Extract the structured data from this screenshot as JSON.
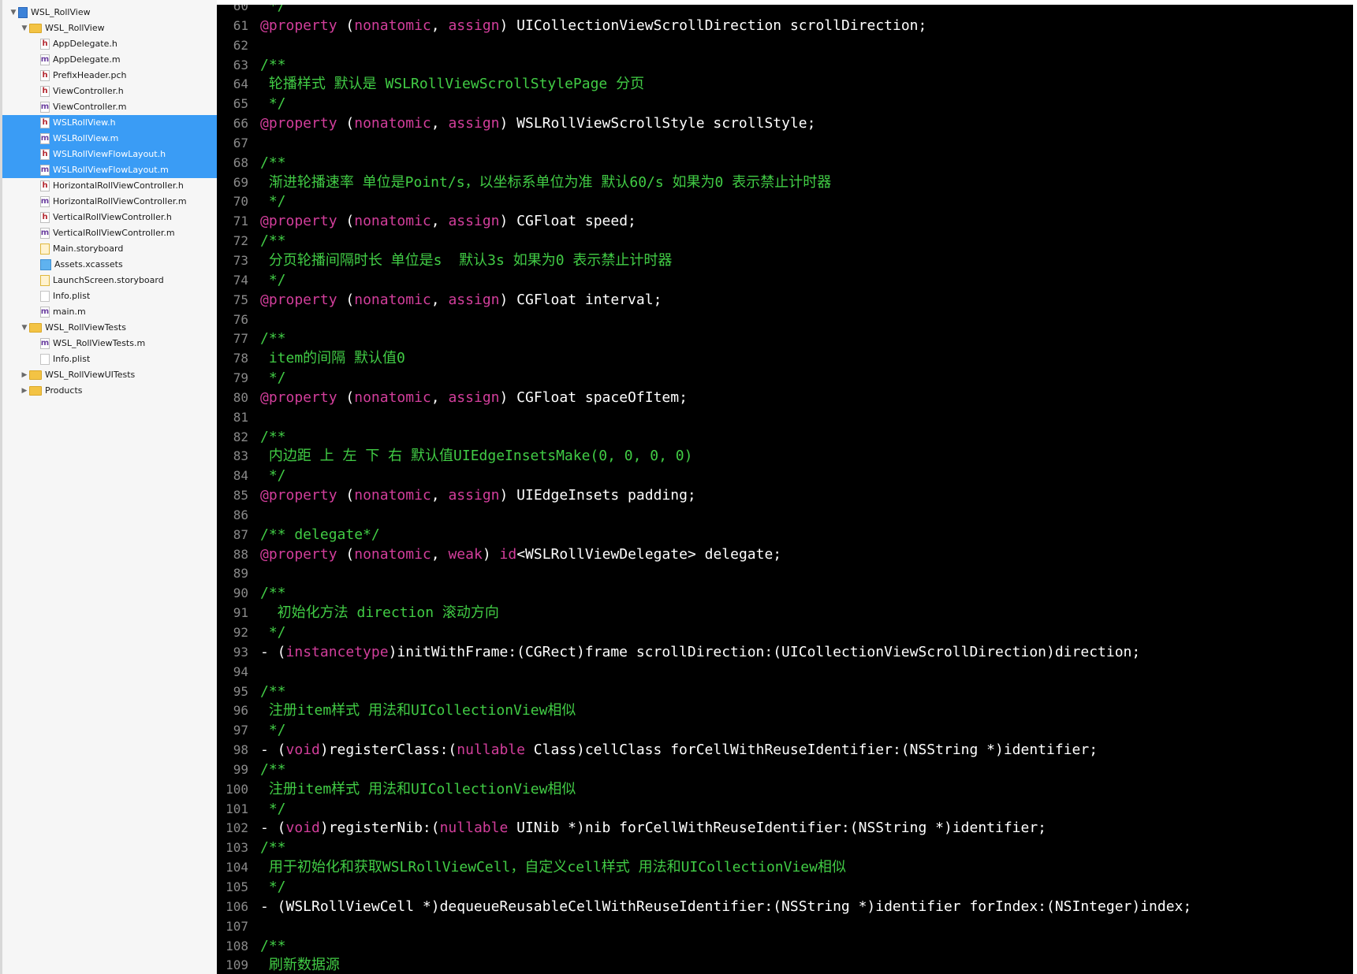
{
  "navigator": {
    "items": [
      {
        "label": "WSL_RollView",
        "kind": "project",
        "depth": 0,
        "disclosure": "open",
        "selected": false,
        "icon": "project-icon"
      },
      {
        "label": "WSL_RollView",
        "kind": "folder",
        "depth": 1,
        "disclosure": "open",
        "selected": false,
        "icon": "folder-icon"
      },
      {
        "label": "AppDelegate.h",
        "kind": "header-file",
        "depth": 2,
        "selected": false,
        "icon": "header-file-icon",
        "glyph": "h"
      },
      {
        "label": "AppDelegate.m",
        "kind": "impl-file",
        "depth": 2,
        "selected": false,
        "icon": "objc-file-icon",
        "glyph": "m"
      },
      {
        "label": "PrefixHeader.pch",
        "kind": "header-file",
        "depth": 2,
        "selected": false,
        "icon": "header-file-icon",
        "glyph": "h"
      },
      {
        "label": "ViewController.h",
        "kind": "header-file",
        "depth": 2,
        "selected": false,
        "icon": "header-file-icon",
        "glyph": "h"
      },
      {
        "label": "ViewController.m",
        "kind": "impl-file",
        "depth": 2,
        "selected": false,
        "icon": "objc-file-icon",
        "glyph": "m"
      },
      {
        "label": "WSLRollView.h",
        "kind": "header-file",
        "depth": 2,
        "selected": true,
        "icon": "header-file-icon",
        "glyph": "h"
      },
      {
        "label": "WSLRollView.m",
        "kind": "impl-file",
        "depth": 2,
        "selected": true,
        "icon": "objc-file-icon",
        "glyph": "m"
      },
      {
        "label": "WSLRollViewFlowLayout.h",
        "kind": "header-file",
        "depth": 2,
        "selected": true,
        "icon": "header-file-icon",
        "glyph": "h"
      },
      {
        "label": "WSLRollViewFlowLayout.m",
        "kind": "impl-file",
        "depth": 2,
        "selected": true,
        "icon": "objc-file-icon",
        "glyph": "m"
      },
      {
        "label": "HorizontalRollViewController.h",
        "kind": "header-file",
        "depth": 2,
        "selected": false,
        "icon": "header-file-icon",
        "glyph": "h"
      },
      {
        "label": "HorizontalRollViewController.m",
        "kind": "impl-file",
        "depth": 2,
        "selected": false,
        "icon": "objc-file-icon",
        "glyph": "m"
      },
      {
        "label": "VerticalRollViewController.h",
        "kind": "header-file",
        "depth": 2,
        "selected": false,
        "icon": "header-file-icon",
        "glyph": "h"
      },
      {
        "label": "VerticalRollViewController.m",
        "kind": "impl-file",
        "depth": 2,
        "selected": false,
        "icon": "objc-file-icon",
        "glyph": "m"
      },
      {
        "label": "Main.storyboard",
        "kind": "storyboard-file",
        "depth": 2,
        "selected": false,
        "icon": "storyboard-file-icon",
        "glyph": ""
      },
      {
        "label": "Assets.xcassets",
        "kind": "assets-file",
        "depth": 2,
        "selected": false,
        "icon": "asset-catalog-icon",
        "glyph": ""
      },
      {
        "label": "LaunchScreen.storyboard",
        "kind": "storyboard-file",
        "depth": 2,
        "selected": false,
        "icon": "storyboard-file-icon",
        "glyph": ""
      },
      {
        "label": "Info.plist",
        "kind": "plist-file",
        "depth": 2,
        "selected": false,
        "icon": "plist-file-icon",
        "glyph": ""
      },
      {
        "label": "main.m",
        "kind": "impl-file",
        "depth": 2,
        "selected": false,
        "icon": "objc-file-icon",
        "glyph": "m"
      },
      {
        "label": "WSL_RollViewTests",
        "kind": "folder",
        "depth": 1,
        "disclosure": "open",
        "selected": false,
        "icon": "folder-icon"
      },
      {
        "label": "WSL_RollViewTests.m",
        "kind": "impl-file",
        "depth": 2,
        "selected": false,
        "icon": "objc-file-icon",
        "glyph": "m"
      },
      {
        "label": "Info.plist",
        "kind": "plist-file",
        "depth": 2,
        "selected": false,
        "icon": "plist-file-icon",
        "glyph": ""
      },
      {
        "label": "WSL_RollViewUITests",
        "kind": "folder",
        "depth": 1,
        "disclosure": "closed",
        "selected": false,
        "icon": "folder-icon"
      },
      {
        "label": "Products",
        "kind": "folder",
        "depth": 1,
        "disclosure": "closed",
        "selected": false,
        "icon": "folder-icon"
      }
    ]
  },
  "editor": {
    "colors": {
      "background": "#000000",
      "comment": "#41cc45",
      "keyword": "#d23e9b",
      "plain": "#ffffff",
      "line_number": "#8a8a8a"
    },
    "lines": [
      {
        "n": "60",
        "tokens": [
          {
            "t": " */",
            "c": "com"
          }
        ]
      },
      {
        "n": "61",
        "tokens": [
          {
            "t": "@property",
            "c": "kw"
          },
          {
            "t": " (",
            "c": "plain"
          },
          {
            "t": "nonatomic",
            "c": "kw"
          },
          {
            "t": ", ",
            "c": "plain"
          },
          {
            "t": "assign",
            "c": "kw"
          },
          {
            "t": ") UICollectionViewScrollDirection scrollDirection;",
            "c": "plain"
          }
        ]
      },
      {
        "n": "62",
        "tokens": []
      },
      {
        "n": "63",
        "tokens": [
          {
            "t": "/**",
            "c": "com"
          }
        ]
      },
      {
        "n": "64",
        "tokens": [
          {
            "t": " 轮播样式 默认是 WSLRollViewScrollStylePage 分页",
            "c": "com"
          }
        ]
      },
      {
        "n": "65",
        "tokens": [
          {
            "t": " */",
            "c": "com"
          }
        ]
      },
      {
        "n": "66",
        "tokens": [
          {
            "t": "@property",
            "c": "kw"
          },
          {
            "t": " (",
            "c": "plain"
          },
          {
            "t": "nonatomic",
            "c": "kw"
          },
          {
            "t": ", ",
            "c": "plain"
          },
          {
            "t": "assign",
            "c": "kw"
          },
          {
            "t": ") WSLRollViewScrollStyle scrollStyle;",
            "c": "plain"
          }
        ]
      },
      {
        "n": "67",
        "tokens": []
      },
      {
        "n": "68",
        "tokens": [
          {
            "t": "/**",
            "c": "com"
          }
        ]
      },
      {
        "n": "69",
        "tokens": [
          {
            "t": " 渐进轮播速率 单位是Point/s，以坐标系单位为准 默认60/s 如果为0 表示禁止计时器",
            "c": "com"
          }
        ]
      },
      {
        "n": "70",
        "tokens": [
          {
            "t": " */",
            "c": "com"
          }
        ]
      },
      {
        "n": "71",
        "tokens": [
          {
            "t": "@property",
            "c": "kw"
          },
          {
            "t": " (",
            "c": "plain"
          },
          {
            "t": "nonatomic",
            "c": "kw"
          },
          {
            "t": ", ",
            "c": "plain"
          },
          {
            "t": "assign",
            "c": "kw"
          },
          {
            "t": ") CGFloat speed;",
            "c": "plain"
          }
        ]
      },
      {
        "n": "72",
        "tokens": [
          {
            "t": "/**",
            "c": "com"
          }
        ]
      },
      {
        "n": "73",
        "tokens": [
          {
            "t": " 分页轮播间隔时长 单位是s  默认3s 如果为0 表示禁止计时器",
            "c": "com"
          }
        ]
      },
      {
        "n": "74",
        "tokens": [
          {
            "t": " */",
            "c": "com"
          }
        ]
      },
      {
        "n": "75",
        "tokens": [
          {
            "t": "@property",
            "c": "kw"
          },
          {
            "t": " (",
            "c": "plain"
          },
          {
            "t": "nonatomic",
            "c": "kw"
          },
          {
            "t": ", ",
            "c": "plain"
          },
          {
            "t": "assign",
            "c": "kw"
          },
          {
            "t": ") CGFloat interval;",
            "c": "plain"
          }
        ]
      },
      {
        "n": "76",
        "tokens": []
      },
      {
        "n": "77",
        "tokens": [
          {
            "t": "/**",
            "c": "com"
          }
        ]
      },
      {
        "n": "78",
        "tokens": [
          {
            "t": " item的间隔 默认值0",
            "c": "com"
          }
        ]
      },
      {
        "n": "79",
        "tokens": [
          {
            "t": " */",
            "c": "com"
          }
        ]
      },
      {
        "n": "80",
        "tokens": [
          {
            "t": "@property",
            "c": "kw"
          },
          {
            "t": " (",
            "c": "plain"
          },
          {
            "t": "nonatomic",
            "c": "kw"
          },
          {
            "t": ", ",
            "c": "plain"
          },
          {
            "t": "assign",
            "c": "kw"
          },
          {
            "t": ") CGFloat spaceOfItem;",
            "c": "plain"
          }
        ]
      },
      {
        "n": "81",
        "tokens": []
      },
      {
        "n": "82",
        "tokens": [
          {
            "t": "/**",
            "c": "com"
          }
        ]
      },
      {
        "n": "83",
        "tokens": [
          {
            "t": " 内边距 上 左 下 右 默认值UIEdgeInsetsMake(0, 0, 0, 0)",
            "c": "com"
          }
        ]
      },
      {
        "n": "84",
        "tokens": [
          {
            "t": " */",
            "c": "com"
          }
        ]
      },
      {
        "n": "85",
        "tokens": [
          {
            "t": "@property",
            "c": "kw"
          },
          {
            "t": " (",
            "c": "plain"
          },
          {
            "t": "nonatomic",
            "c": "kw"
          },
          {
            "t": ", ",
            "c": "plain"
          },
          {
            "t": "assign",
            "c": "kw"
          },
          {
            "t": ") UIEdgeInsets padding;",
            "c": "plain"
          }
        ]
      },
      {
        "n": "86",
        "tokens": []
      },
      {
        "n": "87",
        "tokens": [
          {
            "t": "/** delegate*/",
            "c": "com"
          }
        ]
      },
      {
        "n": "88",
        "tokens": [
          {
            "t": "@property",
            "c": "kw"
          },
          {
            "t": " (",
            "c": "plain"
          },
          {
            "t": "nonatomic",
            "c": "kw"
          },
          {
            "t": ", ",
            "c": "plain"
          },
          {
            "t": "weak",
            "c": "kw"
          },
          {
            "t": ") ",
            "c": "plain"
          },
          {
            "t": "id",
            "c": "kw"
          },
          {
            "t": "<WSLRollViewDelegate> delegate;",
            "c": "plain"
          }
        ]
      },
      {
        "n": "89",
        "tokens": []
      },
      {
        "n": "90",
        "tokens": [
          {
            "t": "/**",
            "c": "com"
          }
        ]
      },
      {
        "n": "91",
        "tokens": [
          {
            "t": "  初始化方法 direction 滚动方向",
            "c": "com"
          }
        ]
      },
      {
        "n": "92",
        "tokens": [
          {
            "t": " */",
            "c": "com"
          }
        ]
      },
      {
        "n": "93",
        "tokens": [
          {
            "t": "- (",
            "c": "plain"
          },
          {
            "t": "instancetype",
            "c": "kw"
          },
          {
            "t": ")initWithFrame:(CGRect)frame scrollDirection:(UICollectionViewScrollDirection)direction;",
            "c": "plain"
          }
        ]
      },
      {
        "n": "94",
        "tokens": []
      },
      {
        "n": "95",
        "tokens": [
          {
            "t": "/**",
            "c": "com"
          }
        ]
      },
      {
        "n": "96",
        "tokens": [
          {
            "t": " 注册item样式 用法和UICollectionView相似",
            "c": "com"
          }
        ]
      },
      {
        "n": "97",
        "tokens": [
          {
            "t": " */",
            "c": "com"
          }
        ]
      },
      {
        "n": "98",
        "tokens": [
          {
            "t": "- (",
            "c": "plain"
          },
          {
            "t": "void",
            "c": "kw"
          },
          {
            "t": ")registerClass:(",
            "c": "plain"
          },
          {
            "t": "nullable",
            "c": "kw"
          },
          {
            "t": " Class)cellClass forCellWithReuseIdentifier:(NSString *)identifier;",
            "c": "plain"
          }
        ]
      },
      {
        "n": "99",
        "tokens": [
          {
            "t": "/**",
            "c": "com"
          }
        ]
      },
      {
        "n": "100",
        "tokens": [
          {
            "t": " 注册item样式 用法和UICollectionView相似",
            "c": "com"
          }
        ]
      },
      {
        "n": "101",
        "tokens": [
          {
            "t": " */",
            "c": "com"
          }
        ]
      },
      {
        "n": "102",
        "tokens": [
          {
            "t": "- (",
            "c": "plain"
          },
          {
            "t": "void",
            "c": "kw"
          },
          {
            "t": ")registerNib:(",
            "c": "plain"
          },
          {
            "t": "nullable",
            "c": "kw"
          },
          {
            "t": " UINib *)nib forCellWithReuseIdentifier:(NSString *)identifier;",
            "c": "plain"
          }
        ]
      },
      {
        "n": "103",
        "tokens": [
          {
            "t": "/**",
            "c": "com"
          }
        ]
      },
      {
        "n": "104",
        "tokens": [
          {
            "t": " 用于初始化和获取WSLRollViewCell，自定义cell样式 用法和UICollectionView相似",
            "c": "com"
          }
        ]
      },
      {
        "n": "105",
        "tokens": [
          {
            "t": " */",
            "c": "com"
          }
        ]
      },
      {
        "n": "106",
        "tokens": [
          {
            "t": "- (WSLRollViewCell *)dequeueReusableCellWithReuseIdentifier:(NSString *)identifier forIndex:(NSInteger)index;",
            "c": "plain"
          }
        ]
      },
      {
        "n": "107",
        "tokens": []
      },
      {
        "n": "108",
        "tokens": [
          {
            "t": "/**",
            "c": "com"
          }
        ]
      },
      {
        "n": "109",
        "tokens": [
          {
            "t": " 刷新数据源",
            "c": "com"
          }
        ]
      }
    ]
  }
}
